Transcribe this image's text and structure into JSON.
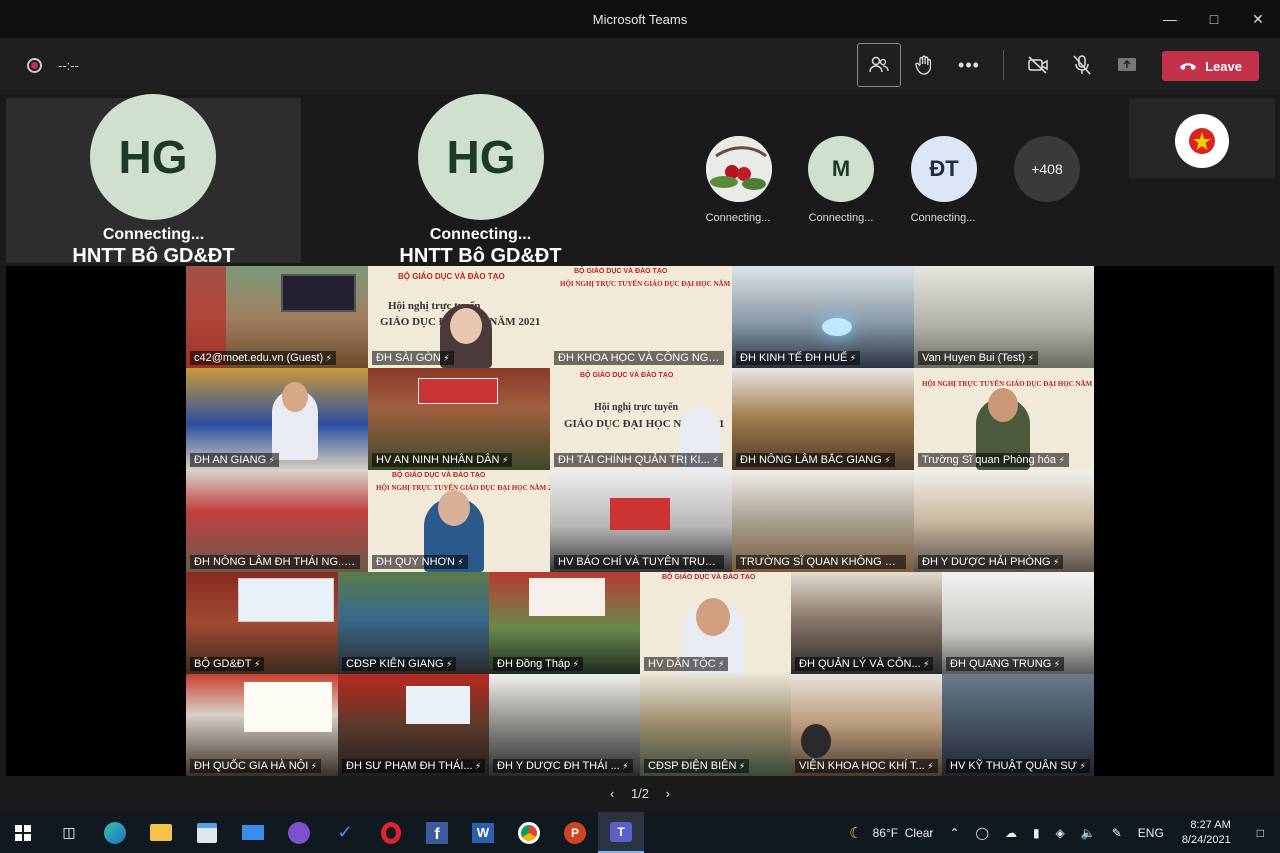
{
  "window": {
    "title": "Microsoft Teams"
  },
  "toolbar": {
    "timer": "--:--",
    "leave_label": "Leave"
  },
  "featured": [
    {
      "initials": "HG",
      "status": "Connecting...",
      "name": "HNTT Bô GD&ĐT"
    },
    {
      "initials": "HG",
      "status": "Connecting...",
      "name": "HNTT Bô GD&ĐT"
    }
  ],
  "small_participants": [
    {
      "initials": "",
      "status": "Connecting...",
      "color": "#e9ece6"
    },
    {
      "initials": "M",
      "status": "Connecting...",
      "color": "#cfe0cf"
    },
    {
      "initials": "ĐT",
      "status": "Connecting...",
      "color": "#dde6f4"
    }
  ],
  "overflow": "+408",
  "grid_labels": [
    "c42@moet.edu.vn (Guest)",
    "ĐH SÀI GÒN",
    "ĐH KHOA HỌC VÀ CÔNG NG...",
    "ĐH KINH TẾ ĐH HUẾ",
    "Van Huyen Bui (Test)",
    "ĐH AN GIANG",
    "HV AN NINH NHÂN DÂN",
    "ĐH TÀI CHÍNH QUẢN TRỊ KI...",
    "ĐH NÔNG LÂM BẮC GIANG",
    "Trường Sĩ quan Phòng hóa",
    "ĐH NÔNG LÂM ĐH THÁI NG...",
    "ĐH QUY NHƠN",
    "HV BÁO CHÍ VÀ TUYÊN TRUY...",
    "TRƯỜNG SĨ QUAN KHÔNG Q...",
    "ĐH Y DƯỢC HẢI PHÒNG",
    "BỘ GD&ĐT",
    "CĐSP KIÊN GIANG",
    "ĐH Đồng Tháp",
    "HV DÂN TỘC",
    "ĐH QUẢN LÝ VÀ CÔN...",
    "ĐH QUANG TRUNG",
    "ĐH QUỐC GIA HÀ NỘI",
    "ĐH SƯ PHẠM ĐH THÁI...",
    "ĐH Y DƯỢC ĐH THÁI ...",
    "CĐSP ĐIỆN BIÊN",
    "VIỆN KHOA HỌC KHÍ T...",
    "HV KỸ THUẬT QUÂN SỰ"
  ],
  "slide_texts": {
    "ministry": "BỘ GIÁO DỤC VÀ ĐÀO TẠO",
    "conf1": "Hội nghị trực tuyến",
    "conf2": "GIÁO DỤC ĐẠI HỌC NĂM 2021",
    "conf_full": "HỘI NGHỊ TRỰC TUYẾN GIÁO DỤC ĐẠI HỌC NĂM 2021"
  },
  "pager": {
    "text": "1/2"
  },
  "taskbar": {
    "weather": "86°F  Clear",
    "lang": "ENG",
    "time": "8:27 AM",
    "date": "8/24/2021"
  },
  "colors": {
    "leave": "#c4314b",
    "accent": "#7fb3f0"
  }
}
